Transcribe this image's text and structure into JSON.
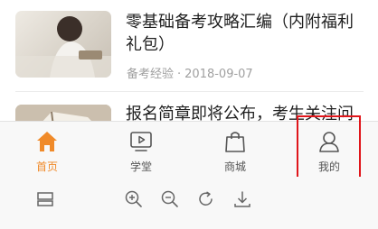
{
  "articles": [
    {
      "title": "零基础备考攻略汇编（内附福利礼包）",
      "category": "备考经验",
      "separator": "·",
      "date": "2018-09-07"
    },
    {
      "title": "报名简章即将公布，考生关注问"
    }
  ],
  "tabbar": {
    "tabs": [
      {
        "label": "首页",
        "icon": "home-icon",
        "active": true
      },
      {
        "label": "学堂",
        "icon": "video-play-icon",
        "active": false
      },
      {
        "label": "商城",
        "icon": "shopping-bag-icon",
        "active": false
      },
      {
        "label": "我的",
        "icon": "user-icon",
        "active": false
      }
    ]
  },
  "toolbar": {
    "icons": [
      "layout-icon",
      "zoom-in-icon",
      "zoom-out-icon",
      "rotate-icon",
      "download-icon"
    ]
  },
  "colors": {
    "accent": "#f08a29",
    "highlight_box": "#e0161b",
    "meta_text": "#a0a0a0"
  }
}
